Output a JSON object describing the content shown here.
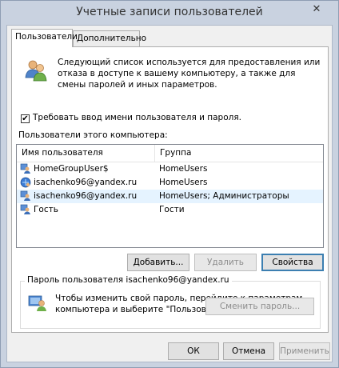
{
  "window": {
    "title": "Учетные записи пользователей",
    "close_glyph": "✕"
  },
  "tabs": [
    {
      "label": "Пользователи",
      "active": true
    },
    {
      "label": "Дополнительно",
      "active": false
    }
  ],
  "intro_text": "Следующий список используется для предоставления или отказа в доступе к вашему компьютеру, а также для смены паролей и иных параметров.",
  "require_password": {
    "checked": true,
    "label": "Требовать ввод имени пользователя и пароля."
  },
  "users_list": {
    "label": "Пользователи этого компьютера:",
    "columns": [
      "Имя пользователя",
      "Группа"
    ],
    "rows": [
      {
        "name": "HomeGroupUser$",
        "group": "HomeUsers",
        "icon": "user-icon"
      },
      {
        "name": "isachenko96@yandex.ru",
        "group": "HomeUsers",
        "icon": "microsoft-account-icon"
      },
      {
        "name": "isachenko96@yandex.ru",
        "group": "HomeUsers; Администраторы",
        "icon": "user-icon",
        "selected": true
      },
      {
        "name": "Гость",
        "group": "Гости",
        "icon": "user-icon"
      }
    ]
  },
  "list_buttons": {
    "add": "Добавить...",
    "remove": "Удалить",
    "properties": "Свойства"
  },
  "password_group": {
    "label": "Пароль пользователя isachenko96@yandex.ru",
    "text": "Чтобы изменить свой пароль, перейдите к параметрам компьютера и выберите \"Пользователи\".",
    "change_button": "Сменить пароль..."
  },
  "dialog_buttons": {
    "ok": "ОК",
    "cancel": "Отмена",
    "apply": "Применить"
  }
}
